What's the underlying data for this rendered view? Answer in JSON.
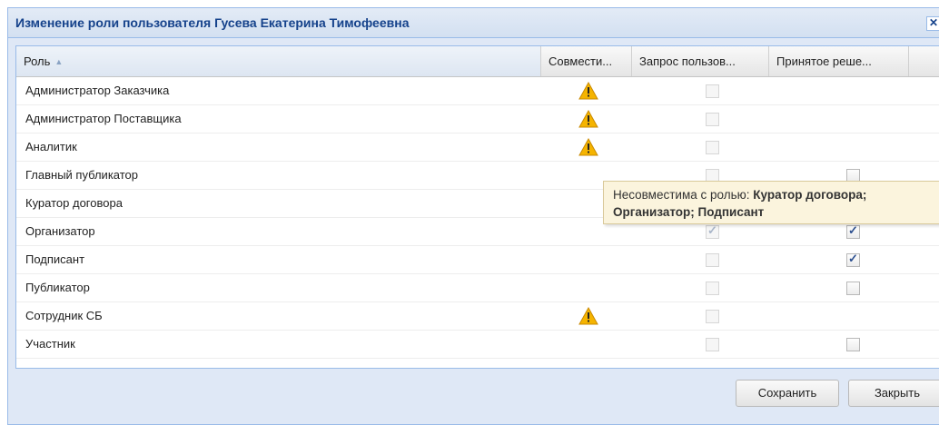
{
  "window": {
    "title": "Изменение роли пользователя Гусева Екатерина Тимофеевна",
    "close_symbol": "✕"
  },
  "grid": {
    "columns": [
      "Роль",
      "Совмести...",
      "Запрос пользов...",
      "Принятое реше..."
    ],
    "sort": {
      "column": "Роль",
      "direction": "asc"
    },
    "rows": [
      {
        "role": "Администратор Заказчика",
        "warning": true,
        "request": "unchecked",
        "decision": "none"
      },
      {
        "role": "Администратор Поставщика",
        "warning": true,
        "request": "unchecked",
        "decision": "none"
      },
      {
        "role": "Аналитик",
        "warning": true,
        "request": "unchecked",
        "decision": "none"
      },
      {
        "role": "Главный публикатор",
        "warning": false,
        "request": "unchecked",
        "decision": "unchecked"
      },
      {
        "role": "Куратор договора",
        "warning": false,
        "request": "none",
        "decision": "none"
      },
      {
        "role": "Организатор",
        "warning": false,
        "request": "checked",
        "decision": "checked"
      },
      {
        "role": "Подписант",
        "warning": false,
        "request": "unchecked",
        "decision": "checked"
      },
      {
        "role": "Публикатор",
        "warning": false,
        "request": "unchecked",
        "decision": "unchecked"
      },
      {
        "role": "Сотрудник СБ",
        "warning": true,
        "request": "unchecked",
        "decision": "none"
      },
      {
        "role": "Участник",
        "warning": false,
        "request": "unchecked",
        "decision": "unchecked"
      }
    ]
  },
  "tooltip": {
    "prefix": "Несовместима с ролью: ",
    "roles_line1": "Куратор договора;",
    "roles_line2": "Организатор; Подписант"
  },
  "buttons": {
    "save": "Сохранить",
    "close": "Закрыть"
  },
  "icons": {
    "warning": "warning-triangle-icon",
    "sort": "sort-ascending-icon"
  },
  "colors": {
    "title_text": "#15428b",
    "window_border": "#99bbe8",
    "tooltip_bg": "#fbf4dd",
    "warning_fill": "#f5b400"
  }
}
